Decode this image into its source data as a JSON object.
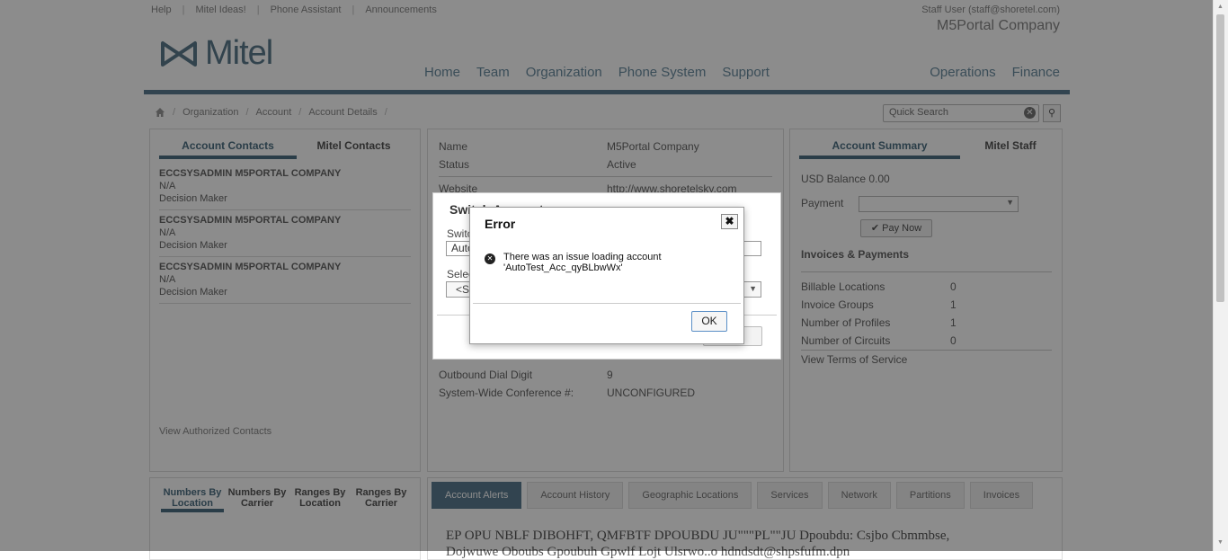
{
  "header": {
    "links": [
      "Help",
      "Mitel Ideas!",
      "Phone Assistant",
      "Announcements"
    ],
    "user": "Staff User (staff@shoretel.com)",
    "company": "M5Portal Company",
    "logo_text": "Mitel"
  },
  "nav": {
    "main": [
      "Home",
      "Team",
      "Organization",
      "Phone System",
      "Support"
    ],
    "right": [
      "Operations",
      "Finance"
    ]
  },
  "breadcrumb": [
    "Organization",
    "Account",
    "Account Details"
  ],
  "search": {
    "placeholder": "Quick Search"
  },
  "contacts_panel": {
    "tabs": [
      "Account Contacts",
      "Mitel Contacts"
    ],
    "contacts": [
      {
        "name": "ECCSYSADMIN M5PORTAL COMPANY",
        "phone": "N/A",
        "role": "Decision Maker"
      },
      {
        "name": "ECCSYSADMIN M5PORTAL COMPANY",
        "phone": "N/A",
        "role": "Decision Maker"
      },
      {
        "name": "ECCSYSADMIN M5PORTAL COMPANY",
        "phone": "N/A",
        "role": "Decision Maker"
      }
    ],
    "footer_link": "View Authorized Contacts"
  },
  "details": {
    "rows": [
      {
        "label": "Name",
        "value": "M5Portal Company"
      },
      {
        "label": "Status",
        "value": "Active"
      },
      {
        "label": "Website",
        "value": "http://www.shoretelsky.com"
      },
      {
        "label": "Outbound Dial Digit",
        "value": "9"
      },
      {
        "label": "System-Wide Conference #:",
        "value": "UNCONFIGURED"
      }
    ]
  },
  "summary": {
    "tabs": [
      "Account Summary",
      "Mitel Staff"
    ],
    "balance": "USD Balance 0.00",
    "payment_label": "Payment",
    "pay_now": "Pay Now",
    "section_title": "Invoices & Payments",
    "rows": [
      {
        "label": "Billable Locations",
        "value": "0"
      },
      {
        "label": "Invoice Groups",
        "value": "1"
      },
      {
        "label": "Number of Profiles",
        "value": "1"
      },
      {
        "label": "Number of Circuits",
        "value": "0"
      }
    ],
    "terms_link": "View Terms of Service"
  },
  "numbers_panel": {
    "tabs": [
      "Numbers By Location",
      "Numbers By Carrier",
      "Ranges By Location",
      "Ranges By Carrier"
    ]
  },
  "bottom_tabs": [
    "Account Alerts",
    "Account History",
    "Geographic Locations",
    "Services",
    "Network",
    "Partitions",
    "Invoices"
  ],
  "alert_text": "EP OPU NBLF DIBOHFT, QMFBTF DPOUBDU JU\"\"\"PL\"\"JU Dpoubdu: Csjbo Cbmmbse,",
  "alert_text2": "Dojwuwe Oboubs Gpoubuh Gpwlf Lojt Ulsrwo..o hdndsdt@shpsfufm.dpn",
  "switch_dialog": {
    "title": "Switch Account",
    "switch_label": "Switc",
    "input_value": "Auto",
    "select_label": "Selec",
    "select_value": "<S",
    "cancel_partial": "el"
  },
  "error_dialog": {
    "title": "Error",
    "message_line1": "There was an issue loading account",
    "message_line2": "'AutoTest_Acc_qyBLbwWx'",
    "ok": "OK"
  }
}
